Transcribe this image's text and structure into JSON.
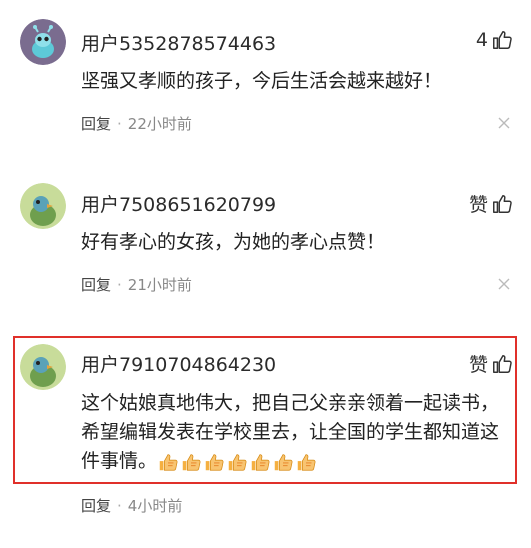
{
  "comments": [
    {
      "username": "用户5352878574463",
      "like_label": "4",
      "text": "坚强又孝顺的孩子，今后生活会越来越好！",
      "reply_label": "回复",
      "separator": "·",
      "time": "22小时前",
      "avatar_icon": "alien-avatar-icon"
    },
    {
      "username": "用户7508651620799",
      "like_label": "赞",
      "text": "好有孝心的女孩，为她的孝心点赞！",
      "reply_label": "回复",
      "separator": "·",
      "time": "21小时前",
      "avatar_icon": "bird-avatar-icon"
    },
    {
      "username": "用户7910704864230",
      "like_label": "赞",
      "text": "这个姑娘真地伟大，把自己父亲亲领着一起读书，希望编辑发表在学校里去，让全国的学生都知道这件事情。",
      "reply_label": "回复",
      "separator": "·",
      "time": "4小时前",
      "avatar_icon": "bird-avatar-icon",
      "emoji_icon": "thumbs-up-emoji-icon",
      "emoji_count": 7
    }
  ],
  "colors": {
    "highlight_border": "#e0302a",
    "meta_text": "#888888"
  }
}
